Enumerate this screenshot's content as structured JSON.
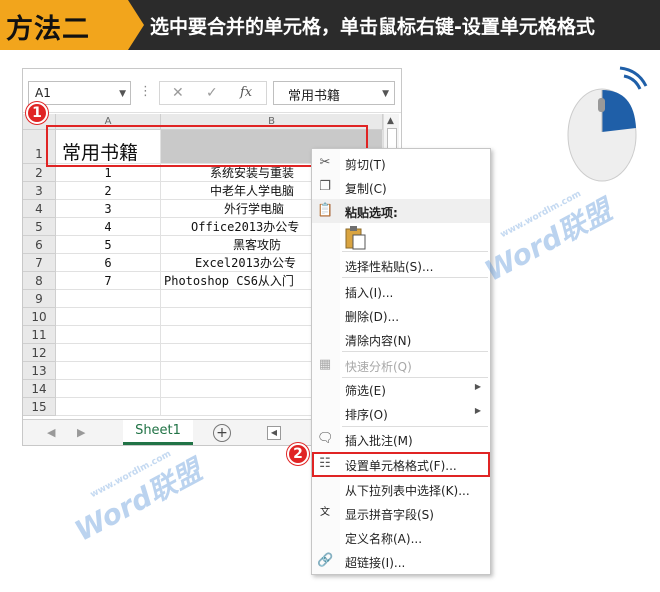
{
  "banner": {
    "tag": "方法二",
    "title": "选中要合并的单元格，单击鼠标右键-设置单元格格式"
  },
  "excel": {
    "namebox": "A1",
    "fx_symbol": "fx",
    "formula_content": "常用书籍",
    "columns": [
      "A",
      "B"
    ],
    "rows": [
      {
        "n": "1",
        "a": "常用书籍",
        "b": ""
      },
      {
        "n": "2",
        "a": "1",
        "b": "系统安装与重装"
      },
      {
        "n": "3",
        "a": "2",
        "b": "中老年人学电脑"
      },
      {
        "n": "4",
        "a": "3",
        "b": "外行学电脑"
      },
      {
        "n": "5",
        "a": "4",
        "b": "Office2013办公专"
      },
      {
        "n": "6",
        "a": "5",
        "b": "黑客攻防"
      },
      {
        "n": "7",
        "a": "6",
        "b": "Excel2013办公专"
      },
      {
        "n": "8",
        "a": "7",
        "b": "Photoshop CS6从入门"
      },
      {
        "n": "9",
        "a": "",
        "b": ""
      },
      {
        "n": "10",
        "a": "",
        "b": ""
      },
      {
        "n": "11",
        "a": "",
        "b": ""
      },
      {
        "n": "12",
        "a": "",
        "b": ""
      },
      {
        "n": "13",
        "a": "",
        "b": ""
      },
      {
        "n": "14",
        "a": "",
        "b": ""
      },
      {
        "n": "15",
        "a": "",
        "b": ""
      }
    ],
    "sheet_tab": "Sheet1",
    "add_sheet": "+"
  },
  "markers": {
    "one": "1",
    "two": "2"
  },
  "context_menu": {
    "items": [
      {
        "label": "剪切(T)",
        "icon": "scissors-icon"
      },
      {
        "label": "复制(C)",
        "icon": "copy-icon"
      },
      {
        "label": "粘贴选项:",
        "icon": "paste-icon",
        "header": true
      },
      {
        "label": "选择性粘贴(S)..."
      },
      {
        "label": "插入(I)..."
      },
      {
        "label": "删除(D)..."
      },
      {
        "label": "清除内容(N)"
      },
      {
        "label": "快速分析(Q)",
        "icon": "quick-analysis-icon",
        "disabled": true
      },
      {
        "label": "筛选(E)",
        "submenu": true
      },
      {
        "label": "排序(O)",
        "submenu": true
      },
      {
        "label": "插入批注(M)",
        "icon": "comment-icon"
      },
      {
        "label": "设置单元格格式(F)...",
        "icon": "format-cells-icon",
        "highlight": true
      },
      {
        "label": "从下拉列表中选择(K)..."
      },
      {
        "label": "显示拼音字段(S)",
        "icon": "pinyin-icon"
      },
      {
        "label": "定义名称(A)..."
      },
      {
        "label": "超链接(I)...",
        "icon": "hyperlink-icon"
      }
    ]
  },
  "watermark": {
    "brand": "Word联盟",
    "url": "www.wordlm.com"
  },
  "colors": {
    "accent_orange": "#f2a51c",
    "highlight_red": "#e02424",
    "excel_green": "#217346",
    "mouse_blue": "#1f5fa8"
  }
}
